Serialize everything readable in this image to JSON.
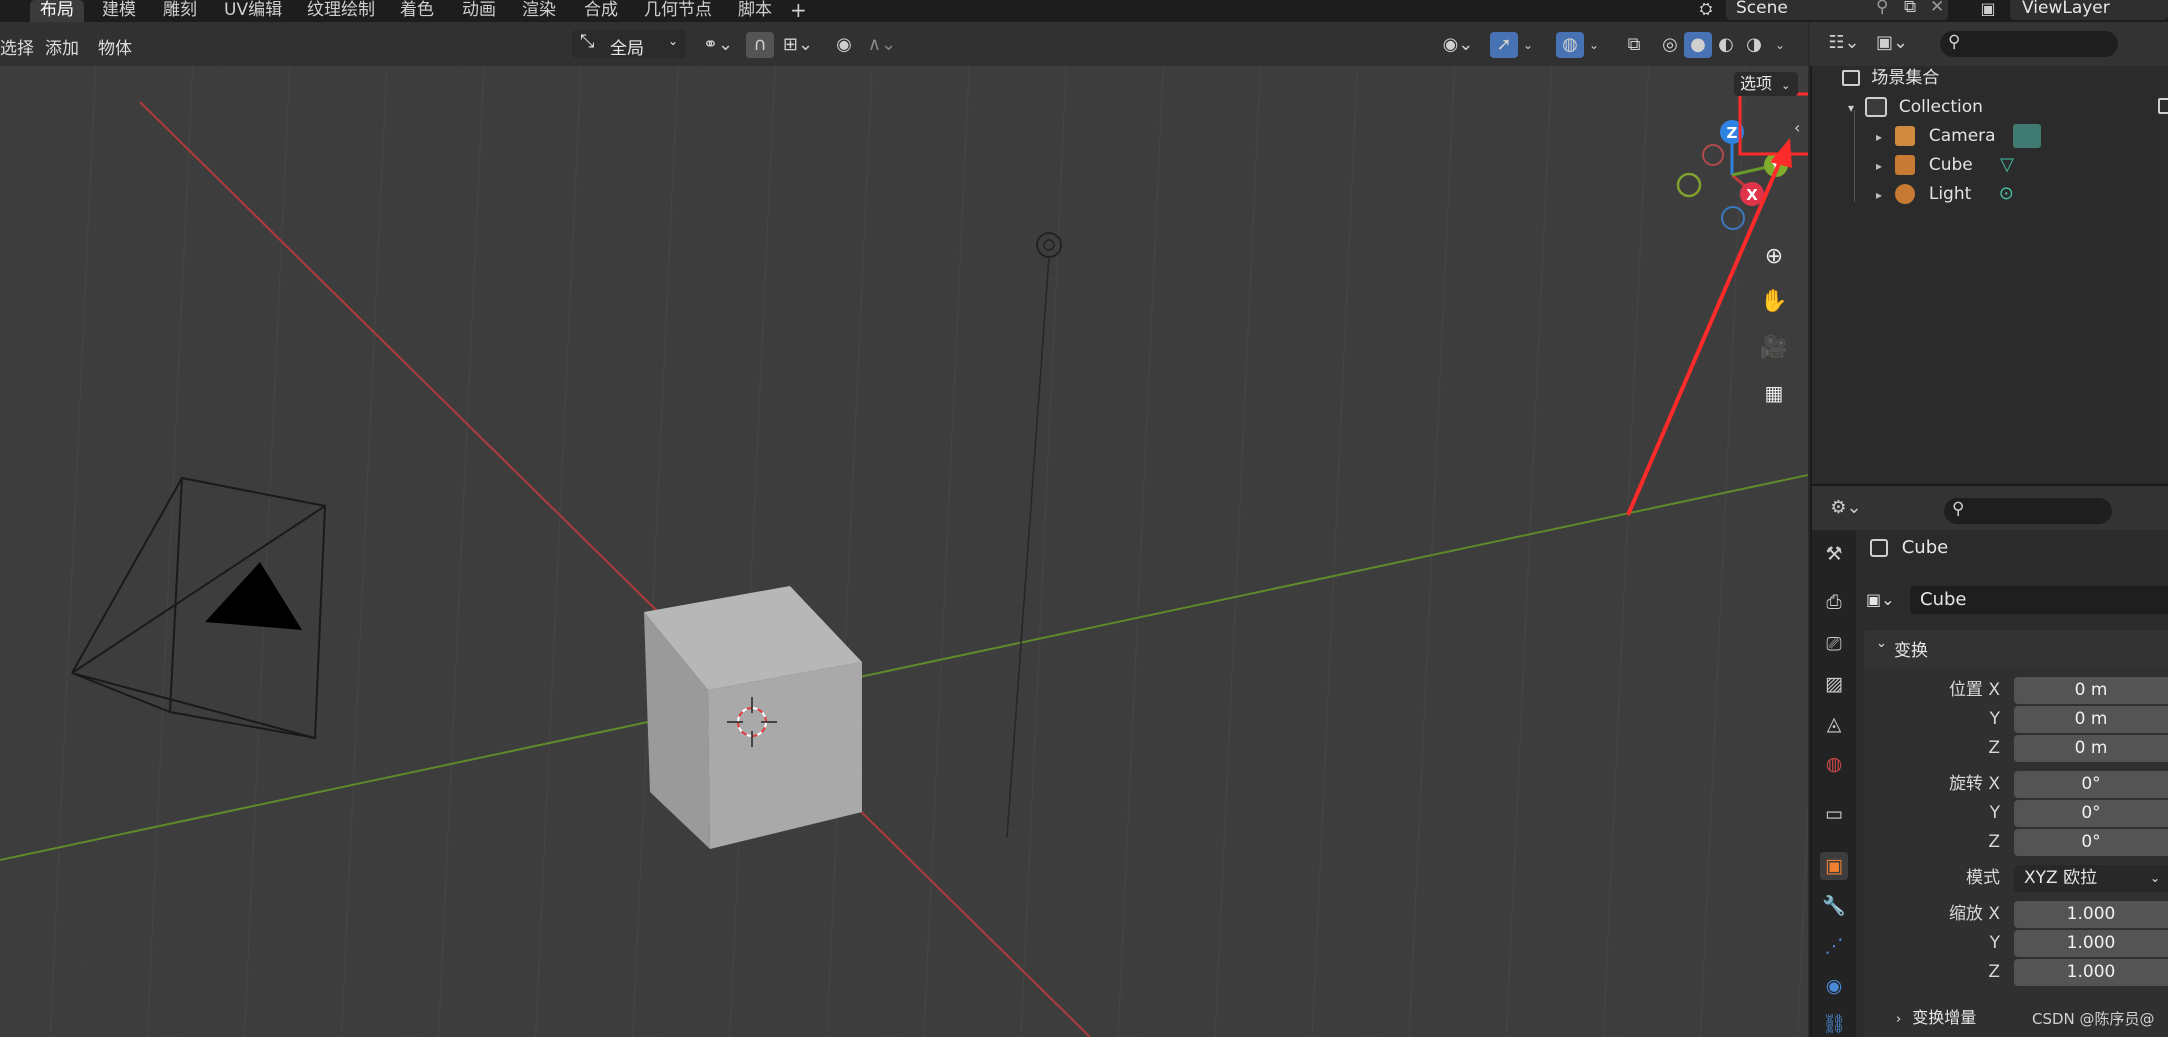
{
  "workspace_tabs": [
    "布局",
    "建模",
    "雕刻",
    "UV编辑",
    "纹理绘制",
    "着色",
    "动画",
    "渲染",
    "合成",
    "几何节点",
    "脚本"
  ],
  "add_tab": "+",
  "scene_name": "Scene",
  "view_layer": "ViewLayer",
  "viewport_menu": {
    "select": "选择",
    "add": "添加",
    "object": "物体"
  },
  "transform_orientation": "全局",
  "options_label": "选项",
  "gizmo": {
    "z": "Z",
    "x": "X",
    "y": "Y"
  },
  "outliner": {
    "scene_collection": "场景集合",
    "collection": "Collection",
    "items": [
      {
        "name": "Camera",
        "icon": "camera-icon"
      },
      {
        "name": "Cube",
        "icon": "mesh-icon"
      },
      {
        "name": "Light",
        "icon": "light-icon"
      }
    ]
  },
  "properties": {
    "object_name": "Cube",
    "object_field": "Cube",
    "transform_section": "变换",
    "location_label": "位置 X",
    "rotation_label": "旋转 X",
    "mode_label": "模式",
    "scale_label": "缩放 X",
    "y_label": "Y",
    "z_label": "Z",
    "location": [
      "0 m",
      "0 m",
      "0 m"
    ],
    "rotation": [
      "0°",
      "0°",
      "0°"
    ],
    "rotation_mode": "XYZ 欧拉",
    "scale": [
      "1.000",
      "1.000",
      "1.000"
    ],
    "delta_section": "变换增量"
  },
  "watermark": "CSDN @陈序员@",
  "colors": {
    "highlight_box": "#ff2a2a",
    "x_axis": "#c0393b",
    "y_axis": "#6a9a2a",
    "z_axis": "#2f83e0"
  }
}
